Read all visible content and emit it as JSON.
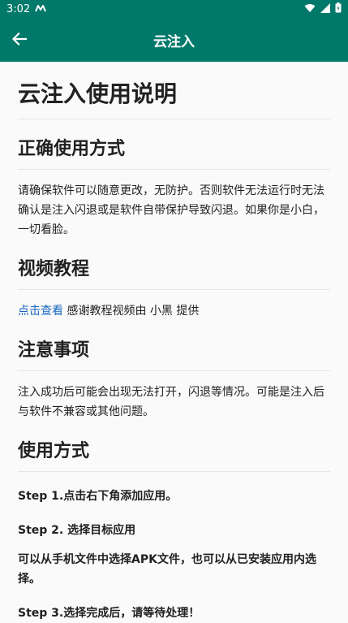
{
  "status_bar": {
    "time": "3:02",
    "notification_icon": "m-logo-icon",
    "icons": [
      "wifi-icon",
      "signal-icon",
      "battery-icon"
    ]
  },
  "app_bar": {
    "title": "云注入",
    "back_icon": "arrow-left-icon"
  },
  "doc": {
    "title": "云注入使用说明",
    "section1": {
      "heading": "正确使用方式",
      "body": "请确保软件可以随意更改，无防护。否则软件无法运行时无法确认是注入闪退或是软件自带保护导致闪退。如果你是小白，一切看脸。"
    },
    "section2": {
      "heading": "视频教程",
      "link": "点击查看",
      "body": " 感谢教程视频由 小黑 提供"
    },
    "section3": {
      "heading": "注意事项",
      "body": "注入成功后可能会出现无法打开，闪退等情况。可能是注入后与软件不兼容或其他问题。"
    },
    "section4": {
      "heading": "使用方式",
      "step1": "Step 1.点击右下角添加应用。",
      "step2": "Step 2. 选择目标应用",
      "step2_desc": "可以从手机文件中选择APK文件，也可以从已安装应用内选择。",
      "step3": "Step 3.选择完成后，请等待处理！"
    }
  },
  "colors": {
    "primary": "#00796b",
    "link": "#1565c0"
  }
}
